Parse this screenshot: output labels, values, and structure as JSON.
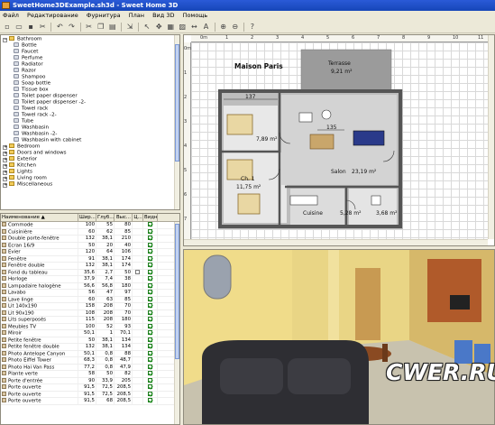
{
  "window": {
    "title": "SweetHome3DExample.sh3d - Sweet Home 3D"
  },
  "menu": [
    "Файл",
    "Редактирование",
    "Фурнитура",
    "План",
    "Вид 3D",
    "Помощь"
  ],
  "toolbar_icons": [
    "new-file-icon",
    "open-icon",
    "save-icon",
    "cut-icon",
    "undo-icon",
    "redo-icon",
    "cut-icon-2",
    "copy-icon",
    "paste-icon",
    "add-furniture-icon",
    "select-icon",
    "pan-icon",
    "create-walls-icon",
    "create-rooms-icon",
    "create-dimensions-icon",
    "add-text-icon",
    "zoom-in-icon",
    "zoom-out-icon",
    "help-icon"
  ],
  "catalog": {
    "items": [
      {
        "label": "Bathroom",
        "type": "folder",
        "expanded": true,
        "level": 0
      },
      {
        "label": "Bottle",
        "type": "item",
        "level": 1
      },
      {
        "label": "Faucet",
        "type": "item",
        "level": 1
      },
      {
        "label": "Perfume",
        "type": "item",
        "level": 1
      },
      {
        "label": "Radiator",
        "type": "item",
        "level": 1
      },
      {
        "label": "Razor",
        "type": "item",
        "level": 1
      },
      {
        "label": "Shampoo",
        "type": "item",
        "level": 1
      },
      {
        "label": "Soap bottle",
        "type": "item",
        "level": 1
      },
      {
        "label": "Tissue box",
        "type": "item",
        "level": 1
      },
      {
        "label": "Toilet paper dispenser",
        "type": "item",
        "level": 1
      },
      {
        "label": "Toilet paper dispenser -2-",
        "type": "item",
        "level": 1
      },
      {
        "label": "Towel rack",
        "type": "item",
        "level": 1
      },
      {
        "label": "Towel rack -2-",
        "type": "item",
        "level": 1
      },
      {
        "label": "Tube",
        "type": "item",
        "level": 1
      },
      {
        "label": "Washbasin",
        "type": "item",
        "level": 1
      },
      {
        "label": "Washbasin -2-",
        "type": "item",
        "level": 1
      },
      {
        "label": "Washbasin with cabinet",
        "type": "item",
        "level": 1
      },
      {
        "label": "Bedroom",
        "type": "folder",
        "expanded": false,
        "level": 0
      },
      {
        "label": "Doors and windows",
        "type": "folder",
        "expanded": false,
        "level": 0
      },
      {
        "label": "Exterior",
        "type": "folder",
        "expanded": false,
        "level": 0
      },
      {
        "label": "Kitchen",
        "type": "folder",
        "expanded": false,
        "level": 0
      },
      {
        "label": "Lights",
        "type": "folder",
        "expanded": false,
        "level": 0
      },
      {
        "label": "Living room",
        "type": "folder",
        "expanded": false,
        "level": 0
      },
      {
        "label": "Miscellaneous",
        "type": "folder",
        "expanded": false,
        "level": 0
      }
    ]
  },
  "furniture_table": {
    "headers": [
      "Наименование ▲",
      "Шир...",
      "Глуб...",
      "Выс...",
      "Ц...",
      "Видно..."
    ],
    "rows": [
      [
        "Commode",
        "100",
        "55",
        "80",
        "",
        "1"
      ],
      [
        "Cuisinière",
        "60",
        "62",
        "85",
        "",
        "1"
      ],
      [
        "Double porte-fenêtre",
        "132",
        "38,1",
        "210",
        "",
        "1"
      ],
      [
        "Ecran 16/9",
        "50",
        "20",
        "40",
        "",
        "1"
      ],
      [
        "Evier",
        "120",
        "64",
        "106",
        "",
        "1"
      ],
      [
        "Fenêtre",
        "91",
        "38,1",
        "174",
        "",
        "1"
      ],
      [
        "Fenêtre double",
        "132",
        "38,1",
        "174",
        "",
        "1"
      ],
      [
        "Fond du tableau",
        "35,6",
        "2,7",
        "50",
        "□",
        "1"
      ],
      [
        "Horloge",
        "37,9",
        "7,4",
        "38",
        "",
        "1"
      ],
      [
        "Lampadaire halogène",
        "56,6",
        "56,8",
        "180",
        "",
        "1"
      ],
      [
        "Lavabo",
        "56",
        "47",
        "97",
        "",
        "1"
      ],
      [
        "Lave linge",
        "60",
        "63",
        "85",
        "",
        "1"
      ],
      [
        "Lit 140x190",
        "158",
        "208",
        "70",
        "",
        "1"
      ],
      [
        "Lit 90x190",
        "108",
        "208",
        "70",
        "",
        "1"
      ],
      [
        "Lits superposés",
        "115",
        "208",
        "180",
        "",
        "1"
      ],
      [
        "Meubles TV",
        "100",
        "52",
        "93",
        "",
        "1"
      ],
      [
        "Miroir",
        "50,1",
        "1",
        "70,1",
        "",
        "1"
      ],
      [
        "Petite fenêtre",
        "50",
        "38,1",
        "134",
        "",
        "1"
      ],
      [
        "Petite fenêtre double",
        "132",
        "38,1",
        "134",
        "",
        "1"
      ],
      [
        "Photo Antelope Canyon",
        "50,1",
        "0,8",
        "88",
        "",
        "1"
      ],
      [
        "Photo Eiffel Tower",
        "68,3",
        "0,8",
        "48,7",
        "",
        "1"
      ],
      [
        "Photo Hai Van Pass",
        "77,2",
        "0,8",
        "47,9",
        "",
        "1"
      ],
      [
        "Plante verte",
        "58",
        "50",
        "82",
        "",
        "1"
      ],
      [
        "Porte d'entrée",
        "90",
        "33,9",
        "205",
        "",
        "1"
      ],
      [
        "Porte ouverte",
        "91,5",
        "72,5",
        "208,5",
        "",
        "1"
      ],
      [
        "Porte ouverte",
        "91,5",
        "72,5",
        "208,5",
        "",
        "1"
      ],
      [
        "Porte ouverte",
        "91,5",
        "68",
        "208,5",
        "",
        "1"
      ]
    ]
  },
  "plan": {
    "ruler_top": [
      "0m",
      "1",
      "2",
      "3",
      "4",
      "5",
      "6",
      "7",
      "8",
      "9",
      "10",
      "11"
    ],
    "ruler_left": [
      "0m",
      "1",
      "2",
      "3",
      "4",
      "5",
      "6",
      "7",
      "8"
    ],
    "labels": {
      "house_name": "Maison Paris",
      "terrace": "Terrasse",
      "terrace_area": "9,21 m²",
      "room1_area": "7,89 m²",
      "bedroom": "Ch. 1",
      "bedroom_area": "11,75 m²",
      "salon": "Salon",
      "salon_area": "23,19 m²",
      "kitchen": "Cuisine",
      "kitchen_area": "5,28 m²",
      "bath_area": "3,68 m²",
      "dim_top": "137",
      "dim_mid": "135"
    }
  },
  "watermark": "CWER.RU",
  "colors": {
    "title_blue": "#1646b8",
    "wall": "#555555",
    "room_floor": "#d3d3d3",
    "sofa": "#2a3a8a",
    "check": "#1a8a1a"
  }
}
